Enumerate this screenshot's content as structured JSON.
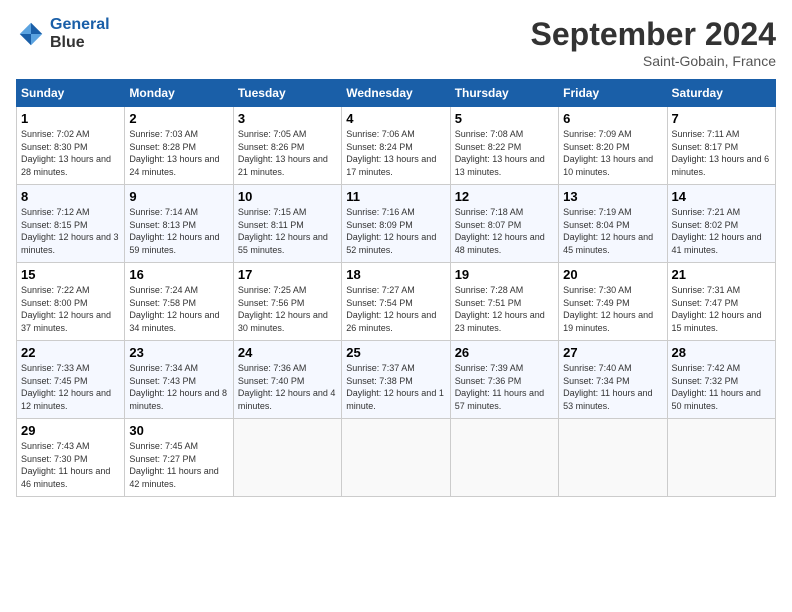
{
  "header": {
    "logo_line1": "General",
    "logo_line2": "Blue",
    "month": "September 2024",
    "location": "Saint-Gobain, France"
  },
  "days_of_week": [
    "Sunday",
    "Monday",
    "Tuesday",
    "Wednesday",
    "Thursday",
    "Friday",
    "Saturday"
  ],
  "weeks": [
    [
      {
        "day": "1",
        "sunrise": "7:02 AM",
        "sunset": "8:30 PM",
        "daylight": "13 hours and 28 minutes."
      },
      {
        "day": "2",
        "sunrise": "7:03 AM",
        "sunset": "8:28 PM",
        "daylight": "13 hours and 24 minutes."
      },
      {
        "day": "3",
        "sunrise": "7:05 AM",
        "sunset": "8:26 PM",
        "daylight": "13 hours and 21 minutes."
      },
      {
        "day": "4",
        "sunrise": "7:06 AM",
        "sunset": "8:24 PM",
        "daylight": "13 hours and 17 minutes."
      },
      {
        "day": "5",
        "sunrise": "7:08 AM",
        "sunset": "8:22 PM",
        "daylight": "13 hours and 13 minutes."
      },
      {
        "day": "6",
        "sunrise": "7:09 AM",
        "sunset": "8:20 PM",
        "daylight": "13 hours and 10 minutes."
      },
      {
        "day": "7",
        "sunrise": "7:11 AM",
        "sunset": "8:17 PM",
        "daylight": "13 hours and 6 minutes."
      }
    ],
    [
      {
        "day": "8",
        "sunrise": "7:12 AM",
        "sunset": "8:15 PM",
        "daylight": "12 hours and 3 minutes."
      },
      {
        "day": "9",
        "sunrise": "7:14 AM",
        "sunset": "8:13 PM",
        "daylight": "12 hours and 59 minutes."
      },
      {
        "day": "10",
        "sunrise": "7:15 AM",
        "sunset": "8:11 PM",
        "daylight": "12 hours and 55 minutes."
      },
      {
        "day": "11",
        "sunrise": "7:16 AM",
        "sunset": "8:09 PM",
        "daylight": "12 hours and 52 minutes."
      },
      {
        "day": "12",
        "sunrise": "7:18 AM",
        "sunset": "8:07 PM",
        "daylight": "12 hours and 48 minutes."
      },
      {
        "day": "13",
        "sunrise": "7:19 AM",
        "sunset": "8:04 PM",
        "daylight": "12 hours and 45 minutes."
      },
      {
        "day": "14",
        "sunrise": "7:21 AM",
        "sunset": "8:02 PM",
        "daylight": "12 hours and 41 minutes."
      }
    ],
    [
      {
        "day": "15",
        "sunrise": "7:22 AM",
        "sunset": "8:00 PM",
        "daylight": "12 hours and 37 minutes."
      },
      {
        "day": "16",
        "sunrise": "7:24 AM",
        "sunset": "7:58 PM",
        "daylight": "12 hours and 34 minutes."
      },
      {
        "day": "17",
        "sunrise": "7:25 AM",
        "sunset": "7:56 PM",
        "daylight": "12 hours and 30 minutes."
      },
      {
        "day": "18",
        "sunrise": "7:27 AM",
        "sunset": "7:54 PM",
        "daylight": "12 hours and 26 minutes."
      },
      {
        "day": "19",
        "sunrise": "7:28 AM",
        "sunset": "7:51 PM",
        "daylight": "12 hours and 23 minutes."
      },
      {
        "day": "20",
        "sunrise": "7:30 AM",
        "sunset": "7:49 PM",
        "daylight": "12 hours and 19 minutes."
      },
      {
        "day": "21",
        "sunrise": "7:31 AM",
        "sunset": "7:47 PM",
        "daylight": "12 hours and 15 minutes."
      }
    ],
    [
      {
        "day": "22",
        "sunrise": "7:33 AM",
        "sunset": "7:45 PM",
        "daylight": "12 hours and 12 minutes."
      },
      {
        "day": "23",
        "sunrise": "7:34 AM",
        "sunset": "7:43 PM",
        "daylight": "12 hours and 8 minutes."
      },
      {
        "day": "24",
        "sunrise": "7:36 AM",
        "sunset": "7:40 PM",
        "daylight": "12 hours and 4 minutes."
      },
      {
        "day": "25",
        "sunrise": "7:37 AM",
        "sunset": "7:38 PM",
        "daylight": "12 hours and 1 minute."
      },
      {
        "day": "26",
        "sunrise": "7:39 AM",
        "sunset": "7:36 PM",
        "daylight": "11 hours and 57 minutes."
      },
      {
        "day": "27",
        "sunrise": "7:40 AM",
        "sunset": "7:34 PM",
        "daylight": "11 hours and 53 minutes."
      },
      {
        "day": "28",
        "sunrise": "7:42 AM",
        "sunset": "7:32 PM",
        "daylight": "11 hours and 50 minutes."
      }
    ],
    [
      {
        "day": "29",
        "sunrise": "7:43 AM",
        "sunset": "7:30 PM",
        "daylight": "11 hours and 46 minutes."
      },
      {
        "day": "30",
        "sunrise": "7:45 AM",
        "sunset": "7:27 PM",
        "daylight": "11 hours and 42 minutes."
      },
      null,
      null,
      null,
      null,
      null
    ]
  ]
}
